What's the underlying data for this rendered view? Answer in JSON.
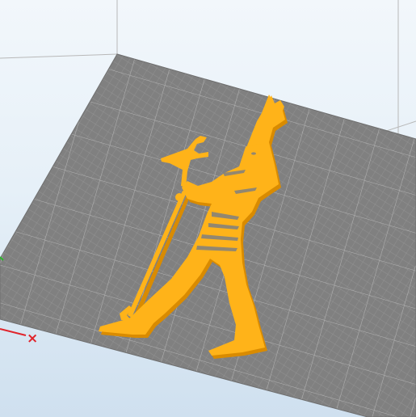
{
  "scene": {
    "type": "3d-print-preview",
    "build_plate": {
      "color": "#808080",
      "grid_color": "#a9a9a9"
    },
    "model": {
      "subject": "egyptian-pharaoh-silhouette",
      "color": "#FFB319",
      "shade_color": "#D98B00"
    },
    "axes": {
      "x_color": "#E0242B",
      "y_color": "#2DB52D"
    },
    "volume_edge_color": "#B8B8B8"
  }
}
